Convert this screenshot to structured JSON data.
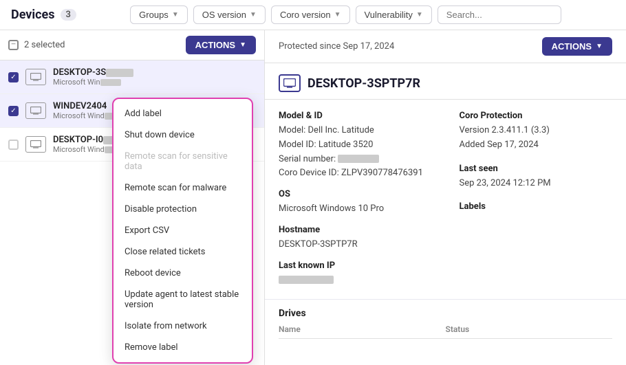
{
  "header": {
    "title": "Devices",
    "badge": "3"
  },
  "filters": {
    "groups_label": "Groups",
    "os_version_label": "OS version",
    "coro_version_label": "Coro version",
    "vulnerability_label": "Vulnerability",
    "search_placeholder": "Search..."
  },
  "list_toolbar": {
    "selected_count": "2 selected",
    "actions_label": "ACTIONS"
  },
  "devices": [
    {
      "name": "DESKTOP-3S",
      "name_blurred": true,
      "os": "Microsoft Win",
      "os_blurred": true,
      "selected": true,
      "id": "device-1"
    },
    {
      "name": "WINDEV2404",
      "name_blurred": false,
      "os": "Microsoft Wind",
      "os_blurred": true,
      "selected": true,
      "id": "device-2"
    },
    {
      "name": "DESKTOP-I0",
      "name_blurred": true,
      "os": "Microsoft Wind",
      "os_blurred": true,
      "selected": false,
      "id": "device-3"
    }
  ],
  "dropdown": {
    "items": [
      {
        "label": "Add label",
        "disabled": false
      },
      {
        "label": "Shut down device",
        "disabled": false
      },
      {
        "label": "Remote scan for sensitive data",
        "disabled": true
      },
      {
        "label": "Remote scan for malware",
        "disabled": false
      },
      {
        "label": "Disable protection",
        "disabled": false
      },
      {
        "label": "Export CSV",
        "disabled": false
      },
      {
        "label": "Close related tickets",
        "disabled": false
      },
      {
        "label": "Reboot device",
        "disabled": false
      },
      {
        "label": "Update agent to latest stable version",
        "disabled": false
      },
      {
        "label": "Isolate from network",
        "disabled": false
      },
      {
        "label": "Remove label",
        "disabled": false
      }
    ]
  },
  "detail": {
    "protected_since": "Protected since Sep 17, 2024",
    "actions_label": "ACTIONS",
    "device_name": "DESKTOP-3SPTP7R",
    "model_id_title": "Model & ID",
    "model_brand": "Model: Dell Inc. Latitude",
    "model_id": "Model ID: Latitude 3520",
    "serial_number_label": "Serial number:",
    "coro_device_id": "Coro Device ID: ZLPV390778476391",
    "os_title": "OS",
    "os_value": "Microsoft Windows 10 Pro",
    "hostname_title": "Hostname",
    "hostname_value": "DESKTOP-3SPTP7R",
    "last_known_ip_title": "Last known IP",
    "coro_protection_title": "Coro Protection",
    "coro_version": "Version 2.3.411.1 (3.3)",
    "added_date": "Added Sep 17, 2024",
    "last_seen_title": "Last seen",
    "last_seen_value": "Sep 23, 2024 12:12 PM",
    "labels_title": "Labels",
    "drives_title": "Drives",
    "drives_col_name": "Name",
    "drives_col_status": "Status"
  }
}
